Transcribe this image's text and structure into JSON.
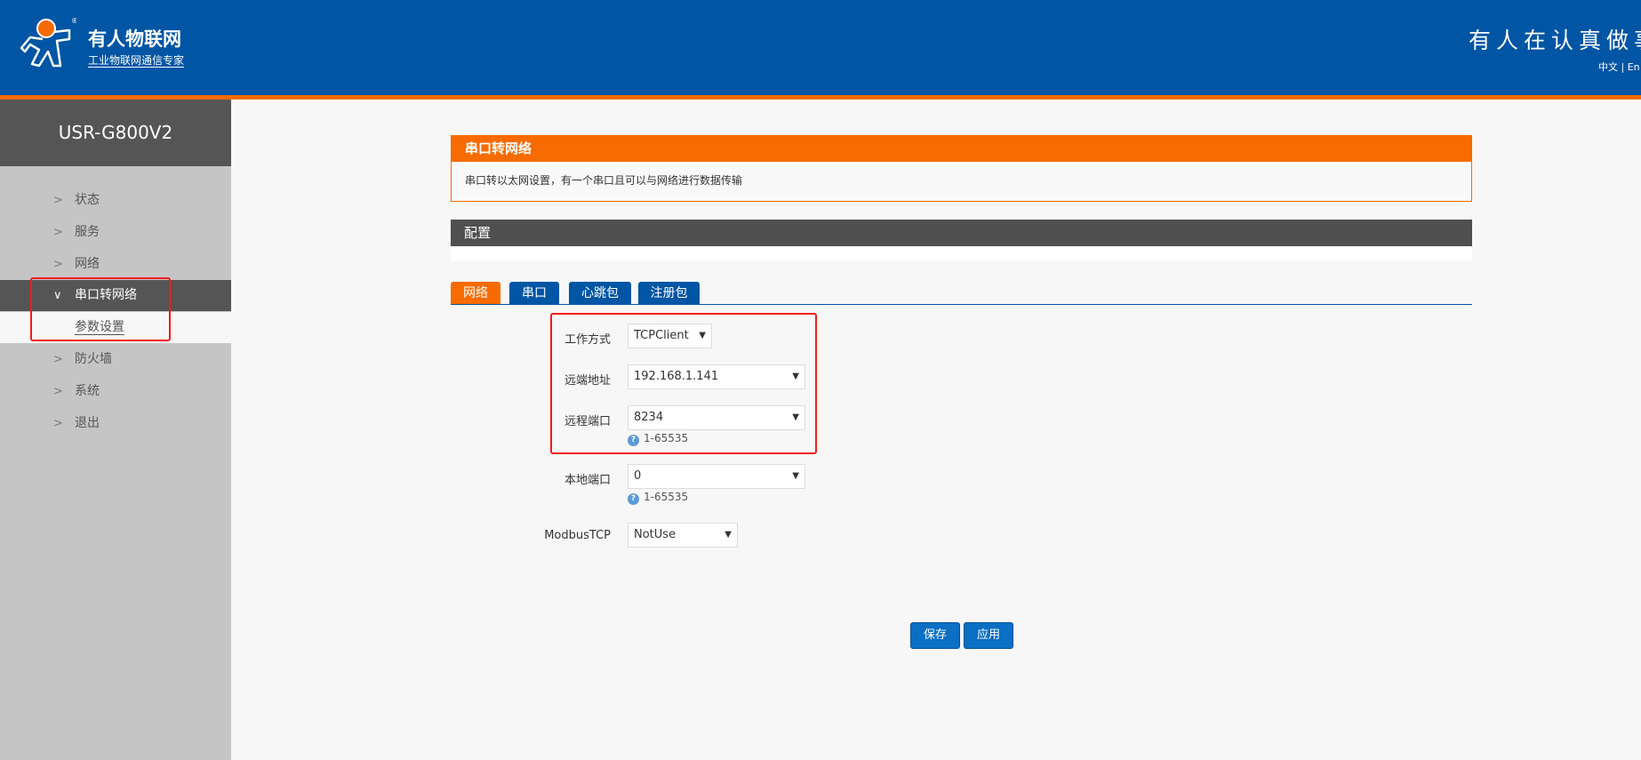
{
  "header": {
    "brand": "有人物联网",
    "brand_sub": "工业物联网通信专家",
    "slogan": "有人在认真做事",
    "lang": "中文 | En"
  },
  "sidebar": {
    "model": "USR-G800V2",
    "items": [
      {
        "label": "状态"
      },
      {
        "label": "服务"
      },
      {
        "label": "网络"
      },
      {
        "label": "串口转网络"
      },
      {
        "label": "防火墙"
      },
      {
        "label": "系统"
      },
      {
        "label": "退出"
      }
    ],
    "sub_item": "参数设置"
  },
  "intro": {
    "title": "串口转网络",
    "desc": "串口转以太网设置，有一个串口且可以与网络进行数据传输"
  },
  "config": {
    "title": "配置"
  },
  "tabs": [
    {
      "label": "网络"
    },
    {
      "label": "串口"
    },
    {
      "label": "心跳包"
    },
    {
      "label": "注册包"
    }
  ],
  "form": {
    "work_mode": {
      "label": "工作方式",
      "value": "TCPClient"
    },
    "remote_addr": {
      "label": "远端地址",
      "value": "192.168.1.141"
    },
    "remote_port": {
      "label": "远程端口",
      "value": "8234",
      "hint": "1-65535"
    },
    "local_port": {
      "label": "本地端口",
      "value": "0",
      "hint": "1-65535"
    },
    "modbus": {
      "label": "ModbusTCP",
      "value": "NotUse"
    }
  },
  "buttons": {
    "save": "保存",
    "apply": "应用"
  },
  "colors": {
    "brand_blue": "#0055a5",
    "accent_orange": "#f76b00",
    "highlight_red": "#f21b1b"
  }
}
